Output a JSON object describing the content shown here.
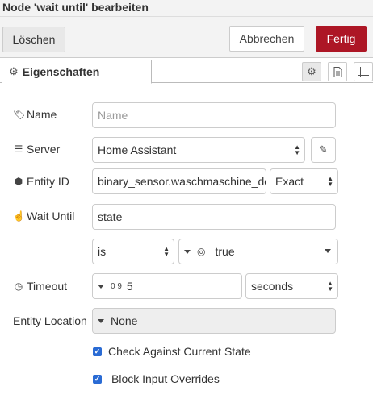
{
  "dialog": {
    "title": "Node 'wait until' bearbeiten"
  },
  "toolbar": {
    "delete_label": "Löschen",
    "cancel_label": "Abbrechen",
    "done_label": "Fertig"
  },
  "tabs": {
    "properties_label": "Eigenschaften"
  },
  "form": {
    "name": {
      "label": "Name",
      "value": "",
      "placeholder": "Name"
    },
    "server": {
      "label": "Server",
      "value": "Home Assistant"
    },
    "entity_id": {
      "label": "Entity ID",
      "value": "binary_sensor.waschmaschine_doc",
      "match": "Exact"
    },
    "wait_until": {
      "label": "Wait Until",
      "value": "state",
      "operator": "is",
      "compare_value": "true"
    },
    "timeout": {
      "label": "Timeout",
      "type_glyph": "0 9",
      "value": "5",
      "units": "seconds"
    },
    "entity_location": {
      "label": "Entity Location",
      "value": "None"
    },
    "check_current_state": {
      "label": "Check Against Current State",
      "checked": true
    },
    "block_input_overrides": {
      "label": "Block Input Overrides",
      "checked": true
    }
  },
  "icons": {
    "tab": "gear-icon",
    "tab_buttons": [
      "gear-icon",
      "document-icon",
      "frame-icon"
    ],
    "name": "tag-icon",
    "server": "server-icon",
    "entity_id": "cube-icon",
    "wait_until": "hand-icon",
    "timeout": "clock-icon",
    "server_edit": "pencil-icon",
    "boolean_type": "toggle-icon"
  },
  "colors": {
    "primary": "#ad1625",
    "checkbox": "#2a6bd4"
  }
}
